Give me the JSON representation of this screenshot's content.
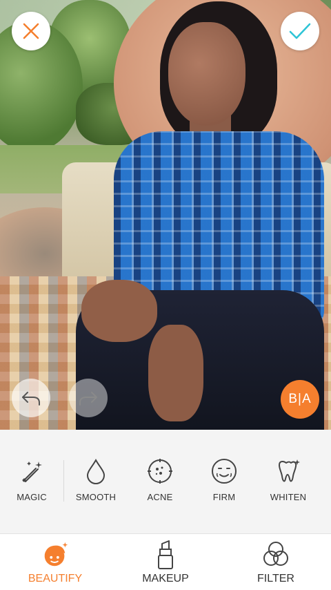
{
  "overlay": {
    "close_icon": "close-icon",
    "confirm_icon": "check-icon",
    "undo_icon": "undo-icon",
    "redo_icon": "redo-icon",
    "compare_label": "B|A"
  },
  "tools": [
    {
      "label": "MAGIC",
      "icon": "magic-wand-icon"
    },
    {
      "label": "SMOOTH",
      "icon": "droplet-icon"
    },
    {
      "label": "ACNE",
      "icon": "acne-target-icon"
    },
    {
      "label": "FIRM",
      "icon": "face-icon"
    },
    {
      "label": "WHITEN",
      "icon": "tooth-icon"
    }
  ],
  "nav": [
    {
      "label": "BEAUTIFY",
      "icon": "beautify-icon",
      "active": true
    },
    {
      "label": "MAKEUP",
      "icon": "lipstick-icon",
      "active": false
    },
    {
      "label": "FILTER",
      "icon": "filter-circles-icon",
      "active": false
    }
  ],
  "colors": {
    "accent": "#f57f2e",
    "confirm": "#2ec4d6",
    "text": "#333333",
    "panel_bg": "#f4f4f4"
  }
}
